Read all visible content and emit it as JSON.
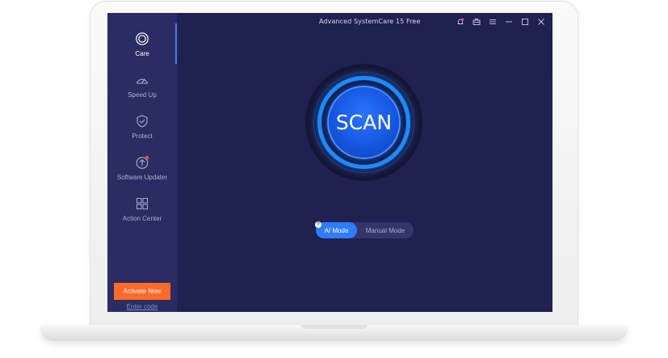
{
  "window": {
    "title": "Advanced SystemCare 15 Free"
  },
  "sidebar": {
    "items": [
      {
        "label": "Care",
        "icon": "care-icon",
        "active": true
      },
      {
        "label": "Speed Up",
        "icon": "speedometer-icon"
      },
      {
        "label": "Protect",
        "icon": "shield-icon"
      },
      {
        "label": "Software Updater",
        "icon": "update-arrow-icon"
      },
      {
        "label": "Action Center",
        "icon": "grid-icon"
      }
    ],
    "activate_label": "Activate Now",
    "enter_code_label": "Enter code"
  },
  "scan": {
    "label": "SCAN"
  },
  "mode": {
    "ai_label": "AI Mode",
    "manual_label": "Manual Mode",
    "help_glyph": "?"
  },
  "colors": {
    "accent": "#2e7cff",
    "activate": "#ff6a29",
    "sidebar_bg": "#2b2d62",
    "main_bg": "#1f2150",
    "notification": "#ff4d4d"
  }
}
